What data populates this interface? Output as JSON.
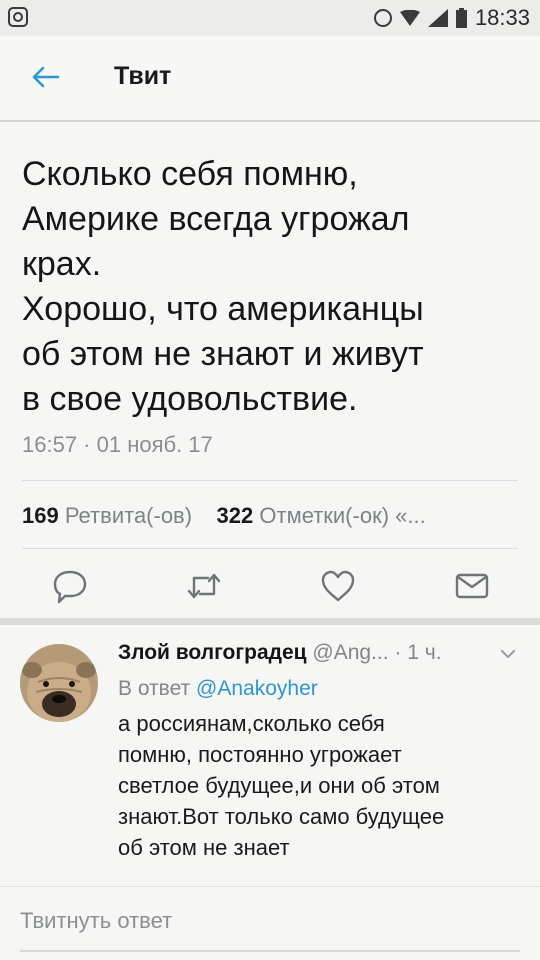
{
  "status_bar": {
    "time": "18:33"
  },
  "header": {
    "title": "Твит"
  },
  "tweet": {
    "lines": [
      "Сколько себя помню,",
      "Америке всегда угрожал",
      "крах.",
      "Хорошо, что американцы",
      "об этом не знают и живут",
      "в свое удовольствие."
    ],
    "timestamp": "16:57 · 01 нояб. 17"
  },
  "stats": {
    "retweets_count": "169",
    "retweets_label": "Ретвита(-ов)",
    "likes_count": "322",
    "likes_label": "Отметки(-ок)",
    "more": "«..."
  },
  "actions": {
    "icons": [
      "reply-icon",
      "retweet-icon",
      "like-icon",
      "share-icon"
    ]
  },
  "reply": {
    "name": "Злой волгоградец",
    "handle": "@Ang...",
    "time": "· 1 ч.",
    "reply_to_prefix": "В ответ",
    "reply_to_mention": "@Anakoyher",
    "text_lines": [
      "а россиянам,сколько себя",
      "помню, постоянно угрожает",
      "светлое будущее,и они об этом",
      "знают.Вот только само будущее",
      "об этом не знает"
    ]
  },
  "compose": {
    "placeholder": "Твитнуть ответ"
  },
  "colors": {
    "accent": "#2f96d4",
    "muted": "#838689",
    "background": "#f6f6f4"
  }
}
